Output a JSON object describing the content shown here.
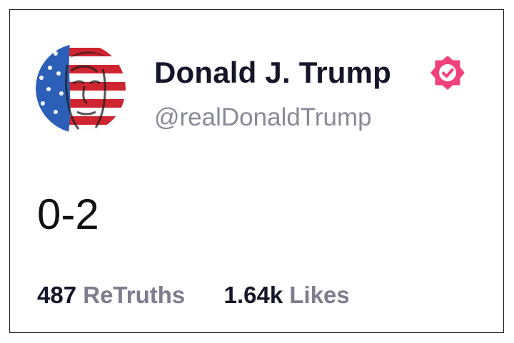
{
  "post": {
    "author": {
      "display_name": "Donald J. Trump",
      "handle": "@realDonaldTrump",
      "verified": true,
      "verified_badge_icon": "verified-badge-icon",
      "verified_color": "#f0417a"
    },
    "text": "0-2",
    "stats": {
      "retruths_count": "487",
      "retruths_label": "ReTruths",
      "likes_count": "1.64k",
      "likes_label": "Likes"
    }
  },
  "colors": {
    "name_text": "#15162a",
    "handle_text": "#8a8a97",
    "stat_label": "#7d7d8f"
  }
}
